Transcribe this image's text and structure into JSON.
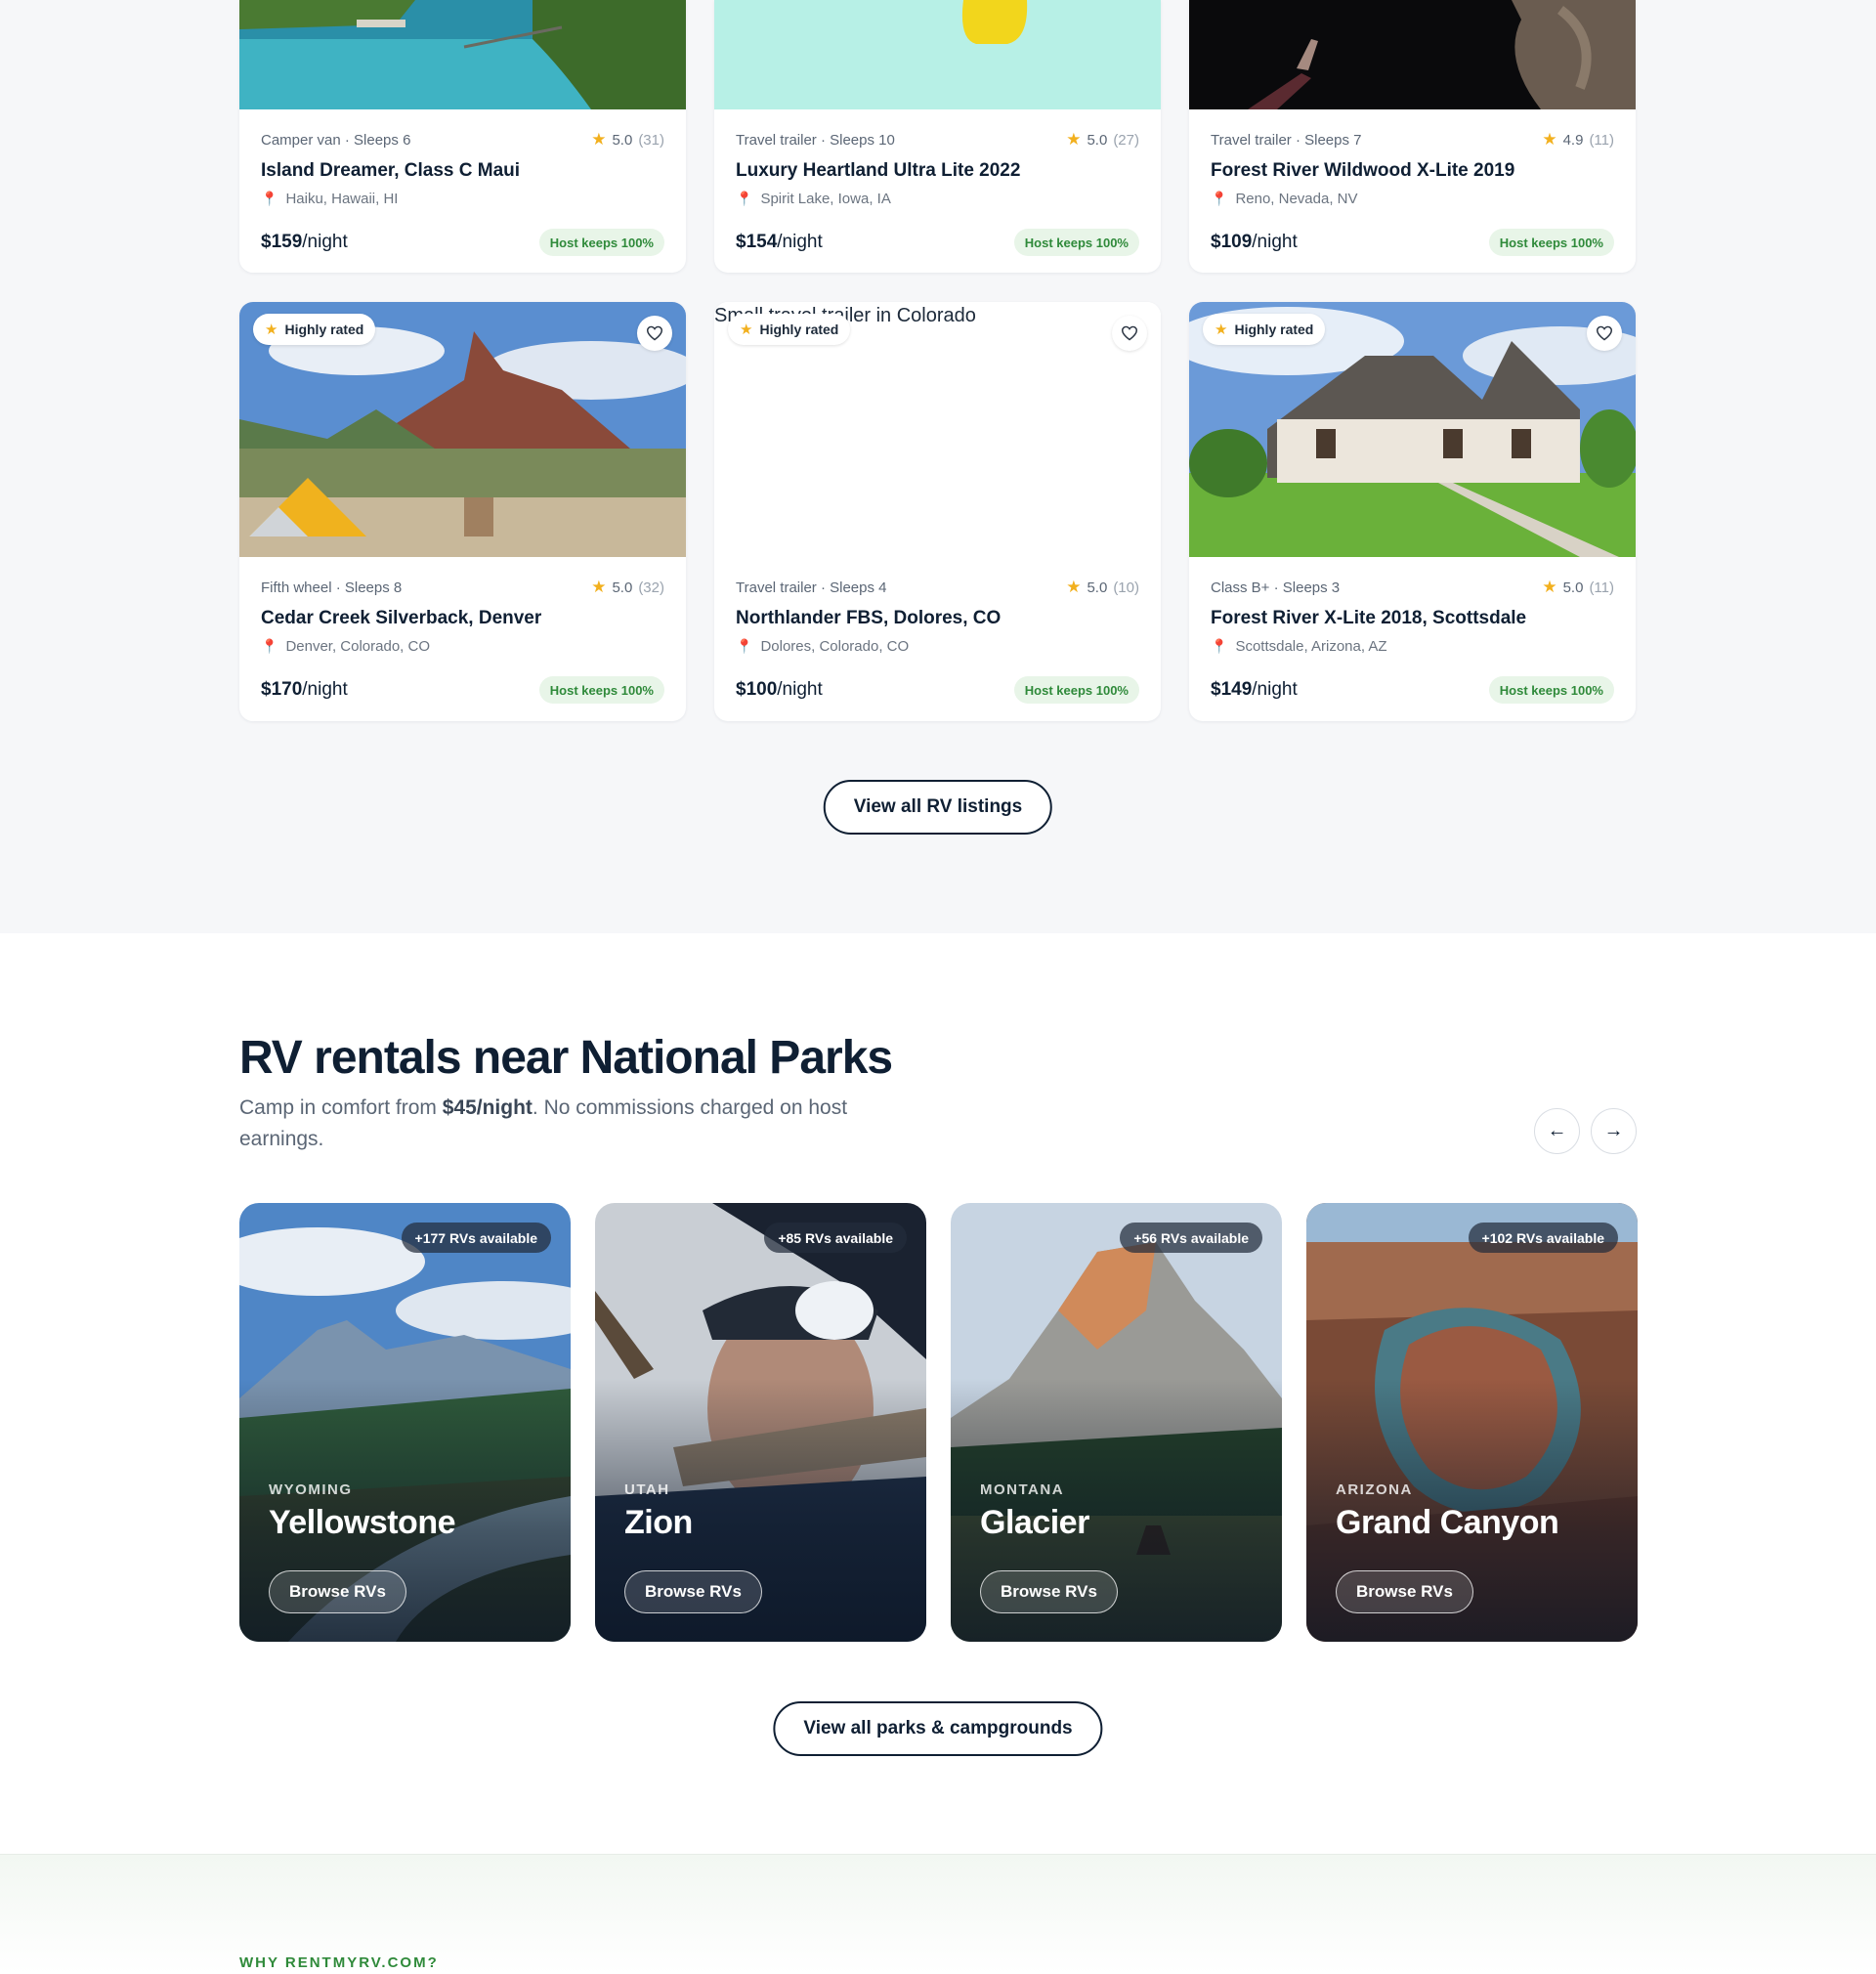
{
  "listings_row1": [
    {
      "type": "Camper van · Sleeps 6",
      "rating": "5.0",
      "count": "(31)",
      "title": "Island Dreamer, Class C Maui",
      "location": "Haiku, Hawaii, HI",
      "price": "$159",
      "per": "/night",
      "host": "Host keeps 100%"
    },
    {
      "type": "Travel trailer · Sleeps 10",
      "rating": "5.0",
      "count": "(27)",
      "title": "Luxury Heartland Ultra Lite 2022",
      "location": "Spirit Lake, Iowa, IA",
      "price": "$154",
      "per": "/night",
      "host": "Host keeps 100%"
    },
    {
      "type": "Travel trailer · Sleeps 7",
      "rating": "4.9",
      "count": "(11)",
      "title": "Forest River Wildwood X-Lite 2019",
      "location": "Reno, Nevada, NV",
      "price": "$109",
      "per": "/night",
      "host": "Host keeps 100%"
    }
  ],
  "listings_row2": [
    {
      "badge": "Highly rated",
      "type": "Fifth wheel · Sleeps 8",
      "rating": "5.0",
      "count": "(32)",
      "title": "Cedar Creek Silverback, Denver",
      "location": "Denver, Colorado, CO",
      "price": "$170",
      "per": "/night",
      "host": "Host keeps 100%"
    },
    {
      "badge": "Highly rated",
      "alt_text": "Small travel trailer in Colorado",
      "type": "Travel trailer · Sleeps 4",
      "rating": "5.0",
      "count": "(10)",
      "title": "Northlander FBS, Dolores, CO",
      "location": "Dolores, Colorado, CO",
      "price": "$100",
      "per": "/night",
      "host": "Host keeps 100%"
    },
    {
      "badge": "Highly rated",
      "type": "Class B+ · Sleeps 3",
      "rating": "5.0",
      "count": "(11)",
      "title": "Forest River X-Lite 2018, Scottsdale",
      "location": "Scottsdale, Arizona, AZ",
      "price": "$149",
      "per": "/night",
      "host": "Host keeps 100%"
    }
  ],
  "view_all_rv": "View all RV listings",
  "parks": {
    "title": "RV rentals near National Parks",
    "subtitle_pre": "Camp in comfort from ",
    "subtitle_bold": "$45/night",
    "subtitle_post": ". No commissions charged on host earnings.",
    "prev_arrow": "←",
    "next_arrow": "→",
    "cards": [
      {
        "state": "WYOMING",
        "name": "Yellowstone",
        "available": "+177 RVs available",
        "browse": "Browse RVs"
      },
      {
        "state": "UTAH",
        "name": "Zion",
        "available": "+85 RVs available",
        "browse": "Browse RVs"
      },
      {
        "state": "MONTANA",
        "name": "Glacier",
        "available": "+56 RVs available",
        "browse": "Browse RVs"
      },
      {
        "state": "ARIZONA",
        "name": "Grand Canyon",
        "available": "+102 RVs available",
        "browse": "Browse RVs"
      }
    ],
    "view_all": "View all parks & campgrounds"
  },
  "why": {
    "label": "WHY RENTMYRV.COM?"
  },
  "icons": {
    "star": "star-icon",
    "pin": "map-pin-icon",
    "heart": "heart-icon"
  },
  "colors": {
    "accent_green": "#2f8a3a",
    "star": "#f2b01e",
    "pin": "#e23b5a",
    "navy": "#0f1f33"
  }
}
